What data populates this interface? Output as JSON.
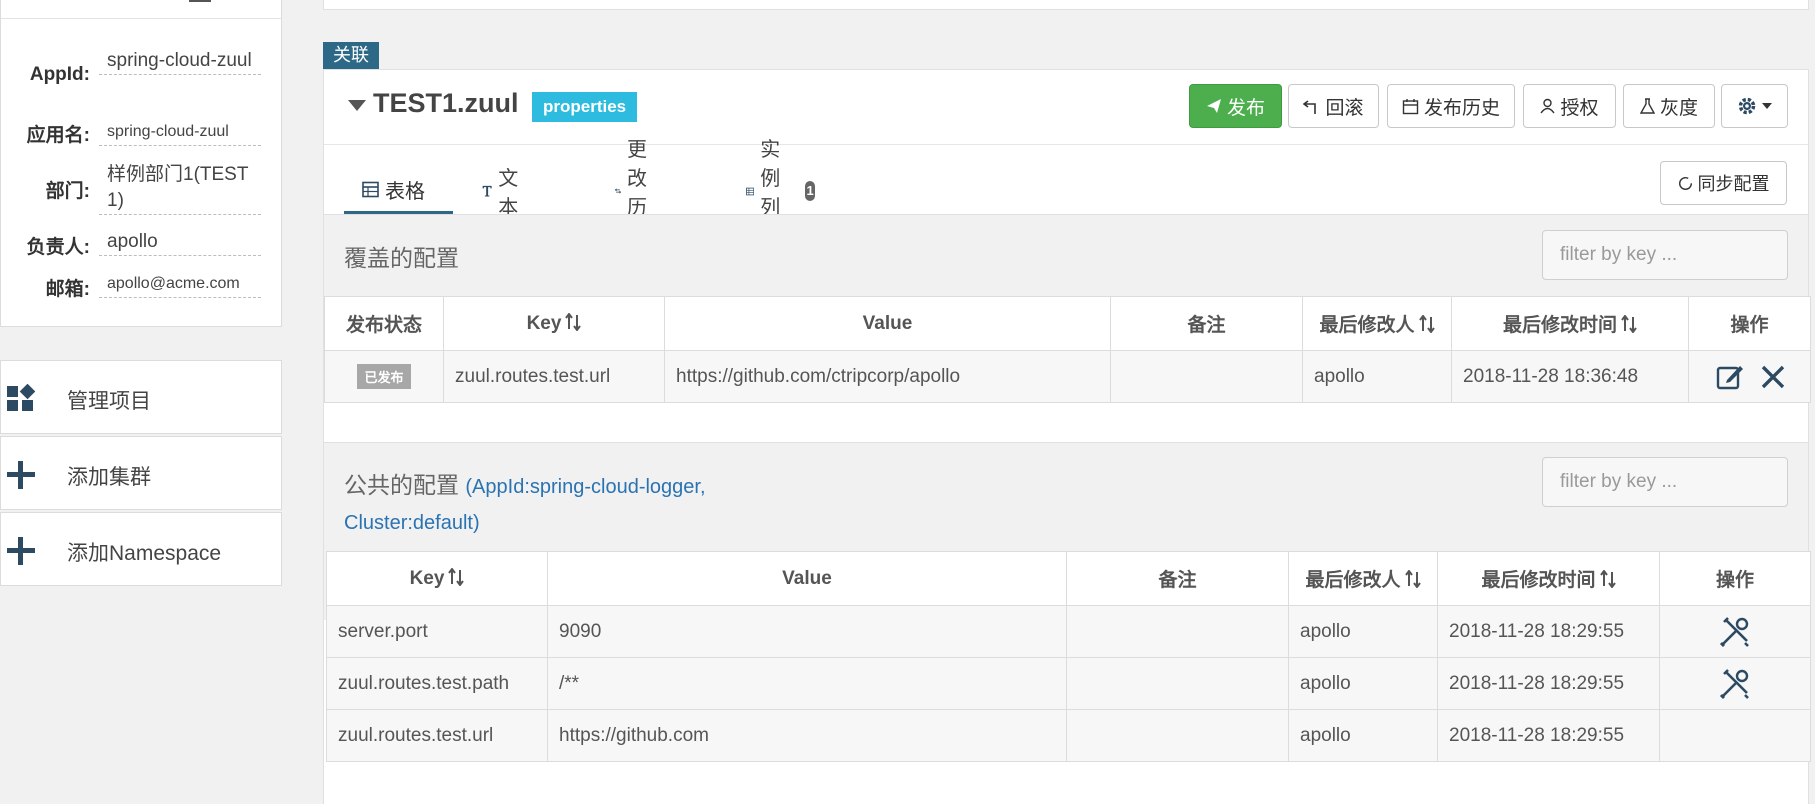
{
  "app_info": {
    "appid_label": "AppId:",
    "appid_value": "spring-cloud-zuul",
    "name_label": "应用名:",
    "name_value": "spring-cloud-zuul",
    "dept_label": "部门:",
    "dept_value": "样例部门1(TEST1)",
    "owner_label": "负责人:",
    "owner_value": "apollo",
    "email_label": "邮箱:",
    "email_value": "apollo@acme.com"
  },
  "sidebar": {
    "items": [
      {
        "label": "管理项目",
        "icon": "dashboard-icon"
      },
      {
        "label": "添加集群",
        "icon": "plus-icon"
      },
      {
        "label": "添加Namespace",
        "icon": "plus-icon"
      }
    ]
  },
  "association_tag": "关联",
  "namespace": {
    "title": "TEST1.zuul",
    "format": "properties"
  },
  "toolbar": {
    "publish": "发布",
    "rollback": "回滚",
    "history": "发布历史",
    "authorize": "授权",
    "gray": "灰度",
    "sync": "同步配置"
  },
  "tabs": [
    {
      "label": "表格",
      "icon": "table-icon",
      "active": true
    },
    {
      "label": "文本",
      "icon": "text-icon"
    },
    {
      "label": "更改历史",
      "icon": "swap-icon"
    },
    {
      "label": "实例列表",
      "icon": "list-icon",
      "badge": "1"
    }
  ],
  "override_section": {
    "title": "覆盖的配置",
    "filter_placeholder": "filter by key ...",
    "columns": [
      "发布状态",
      "Key",
      "Value",
      "备注",
      "最后修改人",
      "最后修改时间",
      "操作"
    ],
    "rows": [
      {
        "status": "已发布",
        "key": "zuul.routes.test.url",
        "value": "https://github.com/ctripcorp/apollo",
        "comment": "",
        "modifier": "apollo",
        "time": "2018-11-28 18:36:48"
      }
    ]
  },
  "public_section": {
    "title": "公共的配置",
    "source": "(AppId:spring-cloud-logger,",
    "cluster": "Cluster:default)",
    "filter_placeholder": "filter by key ...",
    "columns": [
      "Key",
      "Value",
      "备注",
      "最后修改人",
      "最后修改时间",
      "操作"
    ],
    "rows": [
      {
        "key": "server.port",
        "value": "9090",
        "comment": "",
        "modifier": "apollo",
        "time": "2018-11-28 18:29:55",
        "action": "override-icon"
      },
      {
        "key": "zuul.routes.test.path",
        "value": "/**",
        "comment": "",
        "modifier": "apollo",
        "time": "2018-11-28 18:29:55",
        "action": "override-icon"
      },
      {
        "key": "zuul.routes.test.url",
        "value": "https://github.com",
        "comment": "",
        "modifier": "apollo",
        "time": "2018-11-28 18:29:55",
        "action": ""
      }
    ]
  },
  "colors": {
    "primary": "#2d6987",
    "publish_green": "#4cae4c",
    "format_badge": "#2ebbe0",
    "link": "#2a73b3"
  }
}
